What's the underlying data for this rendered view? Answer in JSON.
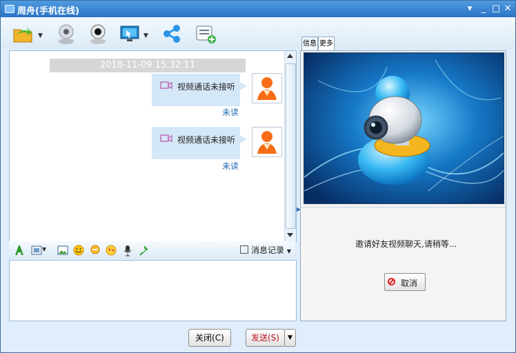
{
  "window": {
    "title": "周舟(手机在线)",
    "controls": [
      "▾",
      "_",
      "□",
      "✕"
    ]
  },
  "toolbar": {
    "icons": [
      "folder-share-icon",
      "webcam-icon",
      "webcam-black-icon",
      "screen-share-icon",
      "share-icon",
      "message-add-icon"
    ]
  },
  "chat": {
    "timestamp": "2018-11-09 15:32:11",
    "messages": [
      {
        "text": "视频通话未接听",
        "status": "未读"
      },
      {
        "text": "视频通话未接听",
        "status": "未读"
      }
    ]
  },
  "input_toolbar": {
    "history_label": "消息记录"
  },
  "buttons": {
    "close_label": "关闭(C)",
    "send_label": "发送(S)"
  },
  "right_panel": {
    "tabs": [
      "信息",
      "更多"
    ],
    "invite_text": "邀请好友视频聊天,请稍等...",
    "cancel_label": "取消"
  },
  "colors": {
    "titlebar": "#2b74c7",
    "message_bubble": "#d5e8f8",
    "link_blue": "#1f6ab0",
    "send_red": "#c0111b"
  }
}
